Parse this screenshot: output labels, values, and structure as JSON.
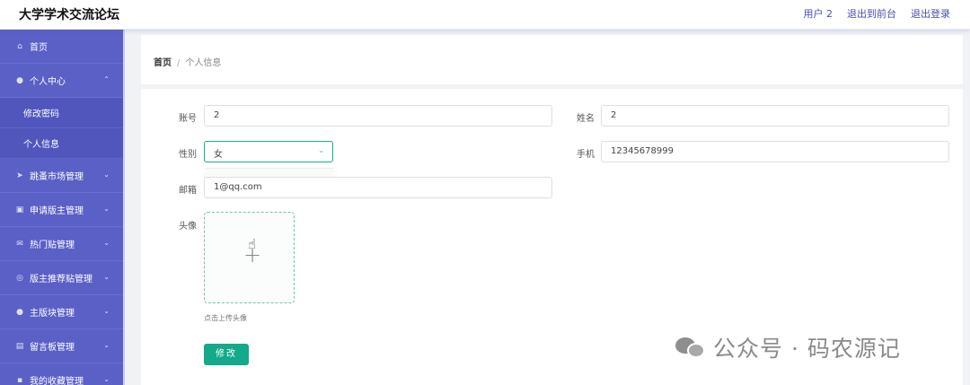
{
  "app": {
    "title": "大学学术交流论坛"
  },
  "header": {
    "user": "用户 2",
    "to_front": "退出到前台",
    "logout": "退出登录"
  },
  "sidebar": {
    "items": [
      {
        "label": "首页",
        "icon": "home-icon",
        "glyph": "⌂",
        "has_chevron": false
      },
      {
        "label": "个人中心",
        "icon": "user-icon",
        "glyph": "●",
        "has_chevron": true,
        "chevron": "⌃"
      },
      {
        "label": "修改密码",
        "sub": true
      },
      {
        "label": "个人信息",
        "sub": true
      },
      {
        "label": "跳蚤市场管理",
        "icon": "send-icon",
        "glyph": "➤",
        "has_chevron": true,
        "chevron": "⌄"
      },
      {
        "label": "申请版主管理",
        "icon": "image-icon",
        "glyph": "▣",
        "has_chevron": true,
        "chevron": "⌄"
      },
      {
        "label": "热门贴管理",
        "icon": "mail-icon",
        "glyph": "✉",
        "has_chevron": true,
        "chevron": "⌄"
      },
      {
        "label": "版主推荐贴管理",
        "icon": "compass-icon",
        "glyph": "◎",
        "has_chevron": true,
        "chevron": "⌄"
      },
      {
        "label": "主版块管理",
        "icon": "location-icon",
        "glyph": "●",
        "has_chevron": true,
        "chevron": "⌄"
      },
      {
        "label": "留言板管理",
        "icon": "ticket-icon",
        "glyph": "▤",
        "has_chevron": true,
        "chevron": "⌄"
      },
      {
        "label": "我的收藏管理",
        "icon": "star-icon",
        "glyph": "▪",
        "has_chevron": true,
        "chevron": "⌄"
      }
    ]
  },
  "breadcrumb": {
    "home": "首页",
    "separator": "/",
    "current": "个人信息"
  },
  "form": {
    "account_label": "账号",
    "account_value": "2",
    "name_label": "姓名",
    "name_value": "2",
    "gender_label": "性别",
    "gender_value": "女",
    "gender_arrow": "⌄",
    "phone_label": "手机",
    "phone_value": "12345678999",
    "email_label": "邮箱",
    "email_value": "1@qq.com",
    "avatar_label": "头像",
    "avatar_plus": "+",
    "upload_tip": "点击上传头像",
    "submit_label": "修改"
  },
  "watermark": {
    "text": "公众号 · 码农源记"
  },
  "colors": {
    "sidebar": "#5b60c6",
    "primary": "#13a98a",
    "link": "#4a4fb0"
  }
}
